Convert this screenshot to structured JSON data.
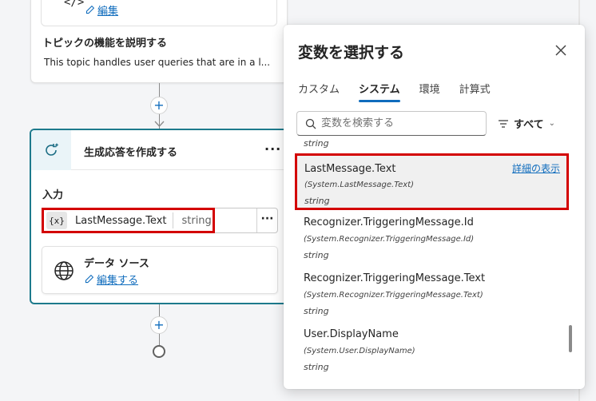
{
  "top_card": {
    "edit_label": "編集",
    "desc_title": "トピックの機能を説明する",
    "desc_text": "This topic handles user queries that are in a l..."
  },
  "main_card": {
    "title": "生成応答を作成する",
    "more": "···",
    "input_label": "入力",
    "variable": {
      "badge": "{x}",
      "name": "LastMessage.Text",
      "type": "string"
    },
    "input_more": "···",
    "data_source": {
      "title": "データ ソース",
      "edit_label": "編集する"
    }
  },
  "panel": {
    "title": "変数を選択する",
    "tabs": [
      {
        "label": "カスタム",
        "active": false
      },
      {
        "label": "システム",
        "active": true
      },
      {
        "label": "環境",
        "active": false
      },
      {
        "label": "計算式",
        "active": false
      }
    ],
    "search_placeholder": "変数を検索する",
    "filter_label": "すべて",
    "partial_type": "string",
    "items": [
      {
        "name": "LastMessage.Text",
        "system": "(System.LastMessage.Text)",
        "type": "string",
        "detail": "詳細の表示"
      },
      {
        "name": "Recognizer.TriggeringMessage.Id",
        "system": "(System.Recognizer.TriggeringMessage.Id)",
        "type": "string"
      },
      {
        "name": "Recognizer.TriggeringMessage.Text",
        "system": "(System.Recognizer.TriggeringMessage.Text)",
        "type": "string"
      },
      {
        "name": "User.DisplayName",
        "system": "(System.User.DisplayName)",
        "type": "string"
      }
    ]
  },
  "colors": {
    "accent": "#0f6cbd",
    "highlight": "#d30000",
    "node_border": "#1d7a8c"
  }
}
